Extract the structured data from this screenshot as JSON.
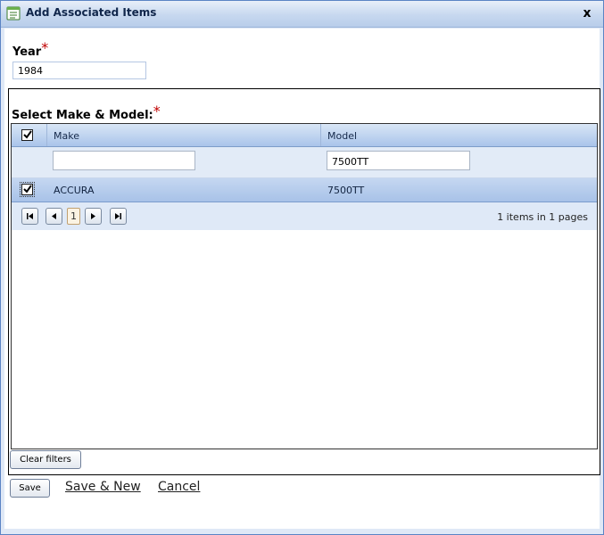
{
  "window": {
    "title": "Add Associated Items",
    "close_label": "x"
  },
  "year": {
    "label": "Year",
    "required_mark": "*",
    "value": "1984"
  },
  "make_model": {
    "label": "Select Make & Model:",
    "required_mark": "*"
  },
  "grid": {
    "columns": [
      "Make",
      "Model"
    ],
    "header_checked": true,
    "filters": {
      "make": "",
      "model": "7500TT"
    },
    "rows": [
      {
        "checked": true,
        "make": "ACCURA",
        "model": "7500TT"
      }
    ]
  },
  "pager": {
    "first_icon": "first-page-icon",
    "prev_icon": "prev-page-icon",
    "current_page": "1",
    "next_icon": "next-page-icon",
    "last_icon": "last-page-icon",
    "info": "1 items in 1 pages"
  },
  "buttons": {
    "clear_filters": "Clear filters",
    "save": "Save",
    "save_new": "Save & New",
    "cancel": "Cancel"
  },
  "colors": {
    "required": "#c00000",
    "titlebar": "#c7d8ef",
    "selected_row": "#b6cbed"
  }
}
